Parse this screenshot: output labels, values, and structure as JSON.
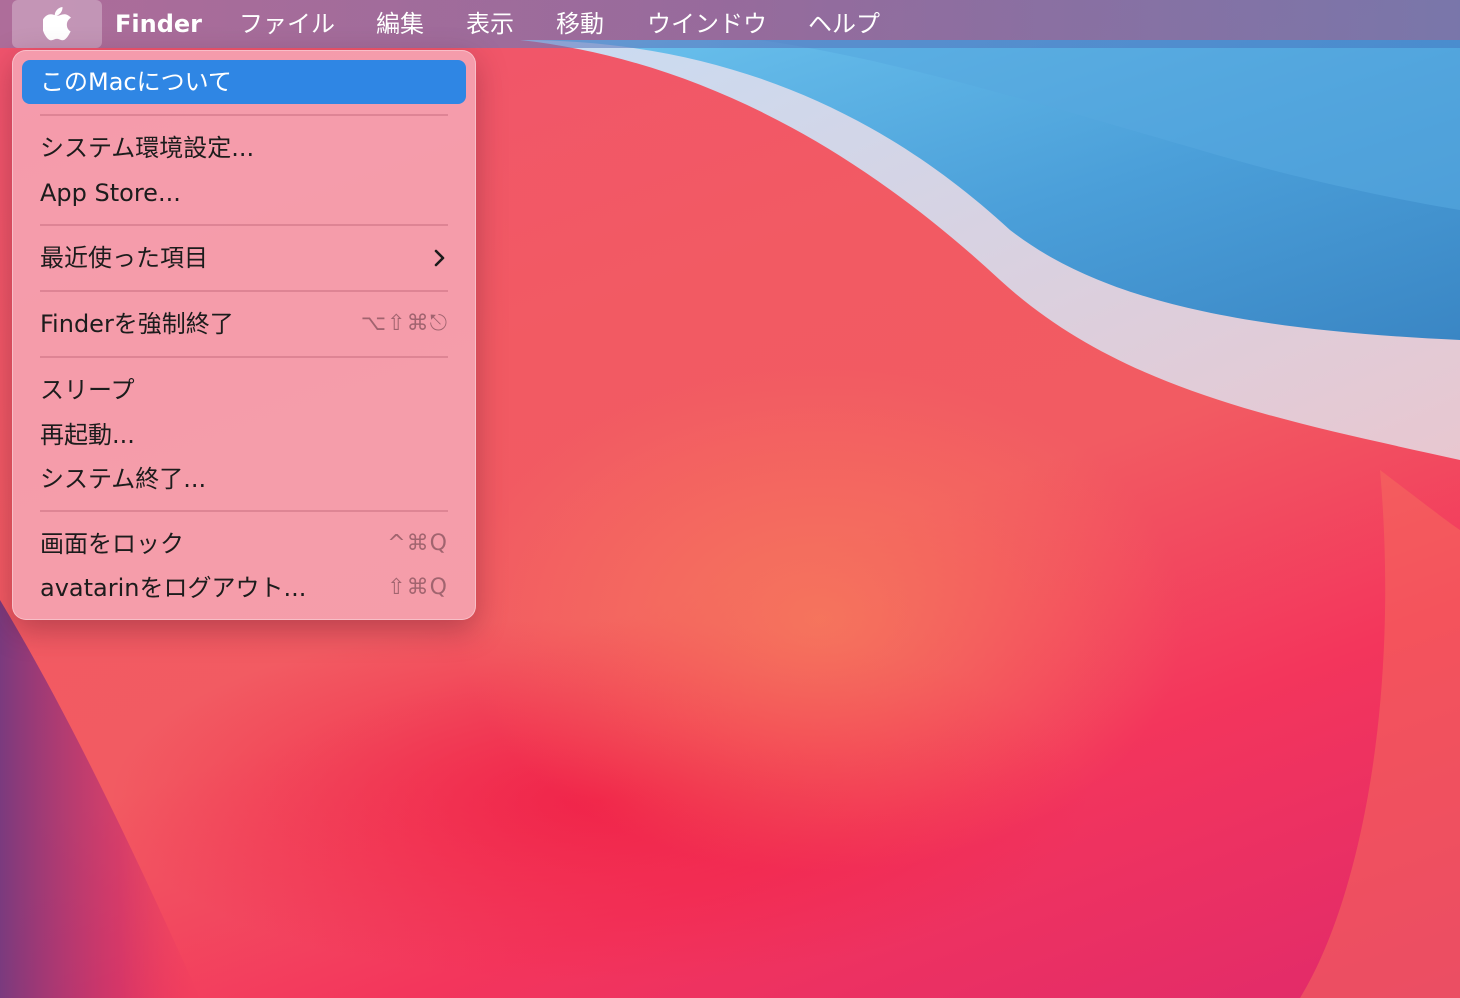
{
  "menubar": {
    "apple_icon": "apple-logo-icon",
    "app_name": "Finder",
    "items": [
      "ファイル",
      "編集",
      "表示",
      "移動",
      "ウインドウ",
      "ヘルプ"
    ]
  },
  "apple_menu": {
    "about": "このMacについて",
    "system_prefs": "システム環境設定...",
    "app_store": "App Store...",
    "recent_items": "最近使った項目",
    "recent_items_icon": "chevron-right-icon",
    "force_quit": "Finderを強制終了",
    "force_quit_shortcut": "⌥⇧⌘⎋",
    "sleep": "スリープ",
    "restart": "再起動...",
    "shutdown": "システム終了...",
    "lock_screen": "画面をロック",
    "lock_screen_shortcut": "^⌘Q",
    "logout": "avatarinをログアウト...",
    "logout_shortcut": "⇧⌘Q"
  },
  "colors": {
    "selection": "#2f86e4",
    "wallpaper_red": "#f25a63",
    "wallpaper_blue": "#4d9fdc"
  }
}
